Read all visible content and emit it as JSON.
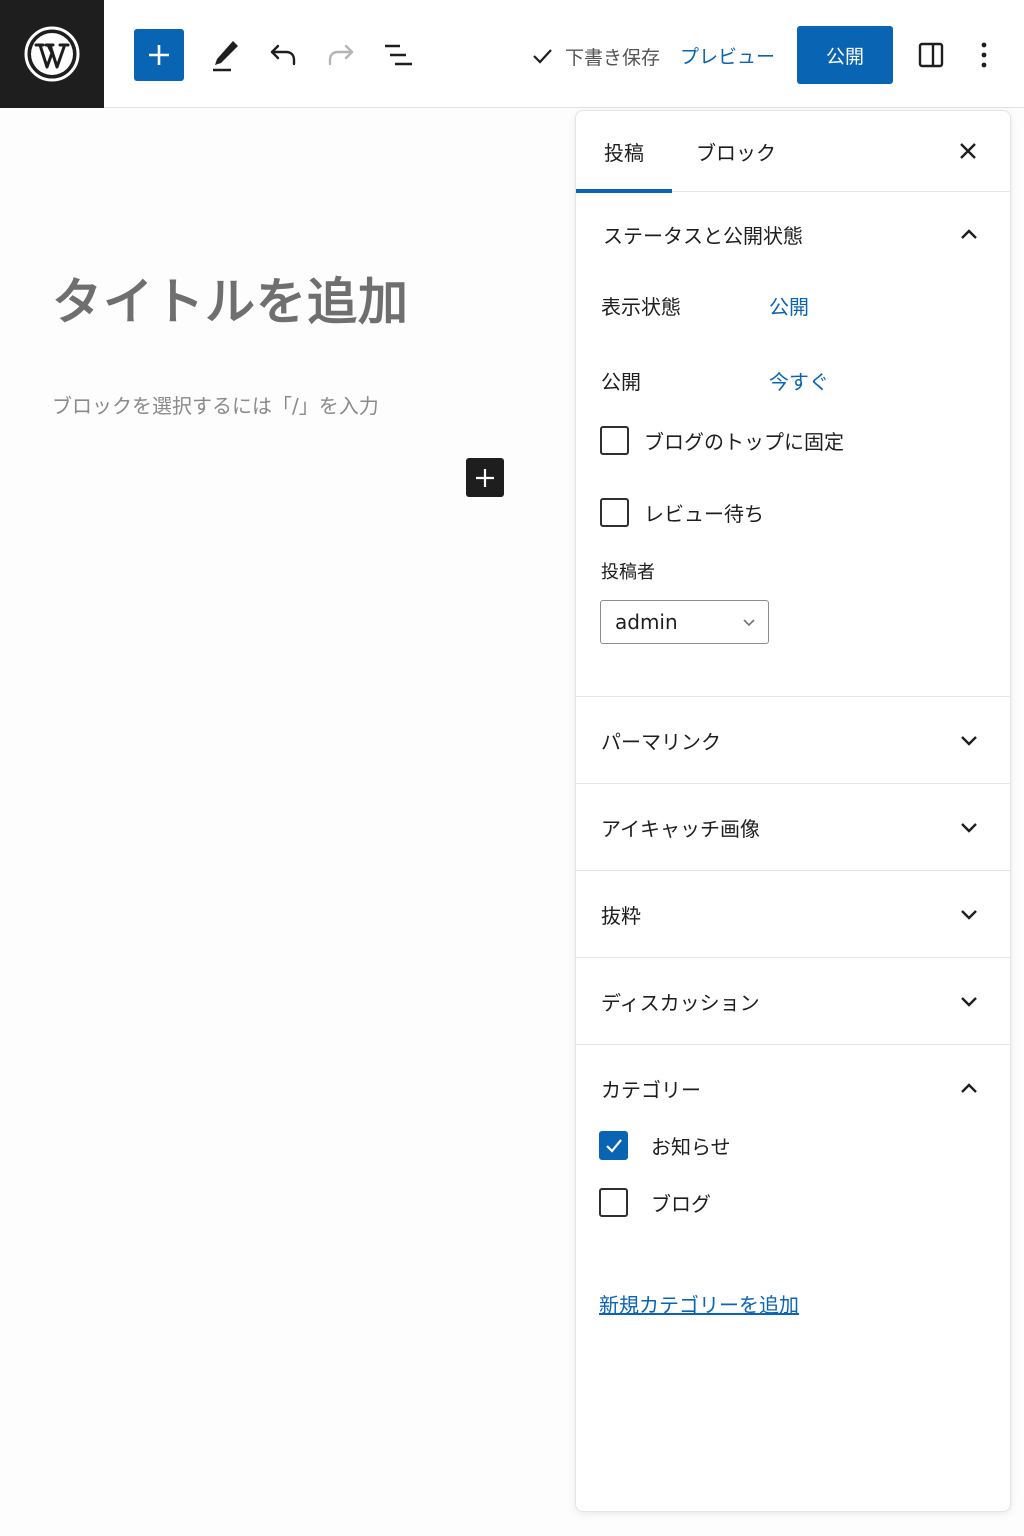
{
  "toolbar": {
    "saved_label": "下書き保存",
    "preview_label": "プレビュー",
    "publish_label": "公開",
    "accent_color": "#0a64b4",
    "icons": [
      "wordpress-logo",
      "plus-icon",
      "pen-icon",
      "undo-icon",
      "redo-icon",
      "list-view-icon",
      "check-icon",
      "sidebar-toggle-icon",
      "more-vertical-icon"
    ]
  },
  "editor": {
    "title_placeholder": "タイトルを追加",
    "block_placeholder": "ブロックを選択するには「/」を入力"
  },
  "sidebar": {
    "tabs": [
      {
        "label": "投稿",
        "active": true
      },
      {
        "label": "ブロック",
        "active": false
      }
    ],
    "status_panel": {
      "title": "ステータスと公開状態",
      "expanded": true,
      "visibility_label": "表示状態",
      "visibility_value": "公開",
      "publish_label": "公開",
      "publish_value": "今すぐ",
      "sticky_label": "ブログのトップに固定",
      "sticky_checked": false,
      "pending_label": "レビュー待ち",
      "pending_checked": false,
      "author_label": "投稿者",
      "author_value": "admin"
    },
    "collapsed_panels": [
      {
        "title": "パーマリンク"
      },
      {
        "title": "アイキャッチ画像"
      },
      {
        "title": "抜粋"
      },
      {
        "title": "ディスカッション"
      }
    ],
    "category_panel": {
      "title": "カテゴリー",
      "expanded": true,
      "categories": [
        {
          "label": "お知らせ",
          "checked": true
        },
        {
          "label": "ブログ",
          "checked": false
        }
      ],
      "add_new_label": "新規カテゴリーを追加"
    }
  }
}
